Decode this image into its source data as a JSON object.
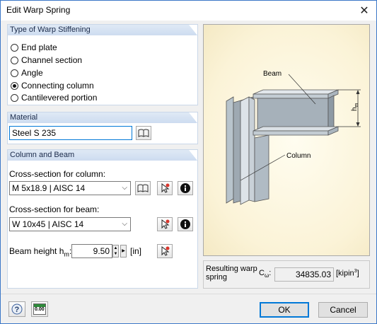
{
  "window": {
    "title": "Edit Warp Spring",
    "close_glyph": "✕"
  },
  "warp_stiffening": {
    "heading": "Type of Warp Stiffening",
    "options": [
      {
        "label": "End plate",
        "selected": false
      },
      {
        "label": "Channel section",
        "selected": false
      },
      {
        "label": "Angle",
        "selected": false
      },
      {
        "label": "Connecting column",
        "selected": true
      },
      {
        "label": "Cantilevered portion",
        "selected": false
      }
    ]
  },
  "material": {
    "heading": "Material",
    "value": "Steel S 235"
  },
  "column_beam": {
    "heading": "Column and Beam",
    "column_label": "Cross-section for column:",
    "column_value": "M 5x18.9 | AISC 14",
    "beam_label": "Cross-section for beam:",
    "beam_value": "W 10x45 | AISC 14",
    "height_label": "Beam height h",
    "height_sub": "m",
    "height_colon": ":",
    "height_value": "9.50",
    "height_unit": "[in]"
  },
  "illustration": {
    "beam_label": "Beam",
    "column_label": "Column",
    "dim_label": "h",
    "dim_sub": "m"
  },
  "result": {
    "label_line1": "Resulting warp",
    "label_line2": "spring",
    "symbol": "C",
    "symbol_sub": "ω",
    "symbol_colon": ":",
    "value": "34835.03",
    "unit": "[kipin",
    "unit_sup": "3",
    "unit_close": "]"
  },
  "footer": {
    "ok_label": "OK",
    "cancel_label": "Cancel",
    "calc_icon_text": "0.00"
  },
  "colors": {
    "accent": "#0078d7",
    "group_header": "#cddcf0",
    "panel_bg": "#f0f0f0"
  }
}
